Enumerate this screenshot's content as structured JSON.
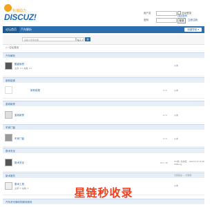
{
  "header": {
    "logo_title": "包装助力",
    "brand": "DISCUZ!",
    "login": {
      "username_label": "用户名",
      "password_label": "密码",
      "auto_login": "自动登录",
      "find_password": "找回密码",
      "login_button": "登录",
      "register": "立即注册"
    }
  },
  "nav": {
    "items": [
      {
        "label": "论坛首页"
      },
      {
        "label": "汽车解析"
      }
    ],
    "quick_button": "快捷导航 ▾"
  },
  "search": {
    "placeholder": "请输入搜索内容",
    "scope": "帖子 ▾",
    "button": "搜"
  },
  "breadcrumb": "⌂ › 论坛首页",
  "sections": [
    {
      "title": "汽车解析",
      "forums": [
        {
          "name": "酷盛新颜",
          "meta": "主题: 3 0, 帖数: 6 0",
          "stat": "",
          "last": "从未"
        }
      ]
    },
    {
      "title": "新新能源",
      "forums": [
        {
          "name": "新新能源",
          "meta": "",
          "stat": "0 / 0",
          "last": "从未"
        }
      ]
    },
    {
      "title": "皇城新秀",
      "forums": [
        {
          "name": "皇城新秀",
          "meta": "",
          "stat": "0 / 0",
          "last": "从未"
        }
      ]
    },
    {
      "title": "车家门窗",
      "forums": [
        {
          "name": "车家门窗",
          "meta": "",
          "stat": "0 / 0",
          "last": "从未"
        }
      ]
    },
    {
      "title": "数术安全",
      "forums": [
        {
          "name": "数术安全",
          "meta": "",
          "stat": "107 / 10",
          "last": "PC端 | 系统变... 2023-5-12 16:36 ZhiRong"
        }
      ]
    },
    {
      "title": "新术服务",
      "forums": [
        {
          "name": "服术工具",
          "meta": "主题: 0, 帖数: 0",
          "stat": "",
          "last": "从未"
        }
      ]
    }
  ],
  "right_note": "分区版主: ---行政秒",
  "footer_section": "汽车资讯情收购服务服务",
  "watermark": "星链秒收录"
}
